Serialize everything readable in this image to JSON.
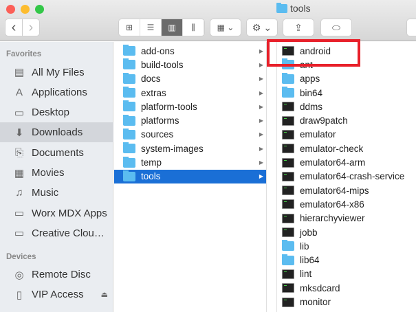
{
  "window": {
    "title": "tools"
  },
  "toolbar": {
    "back": "‹",
    "forward": "›",
    "view_icon": "⊞",
    "view_list": "☰",
    "view_column": "▥",
    "view_cover": "⫼",
    "arrange": "▦ ⌄",
    "action": "⚙ ⌄",
    "share": "⇪",
    "tags": "⬭"
  },
  "sidebar": {
    "favorites_header": "Favorites",
    "favorites": [
      {
        "label": "All My Files",
        "icon": "▤"
      },
      {
        "label": "Applications",
        "icon": "A"
      },
      {
        "label": "Desktop",
        "icon": "▭"
      },
      {
        "label": "Downloads",
        "icon": "⬇",
        "selected": true
      },
      {
        "label": "Documents",
        "icon": "⎘"
      },
      {
        "label": "Movies",
        "icon": "▦"
      },
      {
        "label": "Music",
        "icon": "♫"
      },
      {
        "label": "Worx MDX Apps",
        "icon": "▭"
      },
      {
        "label": "Creative Clou…",
        "icon": "▭"
      }
    ],
    "devices_header": "Devices",
    "devices": [
      {
        "label": "Remote Disc",
        "icon": "◎"
      },
      {
        "label": "VIP Access",
        "icon": "▯",
        "eject": "⏏"
      }
    ]
  },
  "column1": [
    {
      "name": "add-ons"
    },
    {
      "name": "build-tools"
    },
    {
      "name": "docs"
    },
    {
      "name": "extras"
    },
    {
      "name": "platform-tools"
    },
    {
      "name": "platforms"
    },
    {
      "name": "sources"
    },
    {
      "name": "system-images"
    },
    {
      "name": "temp"
    },
    {
      "name": "tools",
      "selected": true
    }
  ],
  "column1_arrow": "▶",
  "column2": [
    {
      "name": "android",
      "type": "exec"
    },
    {
      "name": "ant",
      "type": "folder"
    },
    {
      "name": "apps",
      "type": "folder"
    },
    {
      "name": "bin64",
      "type": "folder"
    },
    {
      "name": "ddms",
      "type": "exec"
    },
    {
      "name": "draw9patch",
      "type": "exec"
    },
    {
      "name": "emulator",
      "type": "exec"
    },
    {
      "name": "emulator-check",
      "type": "exec"
    },
    {
      "name": "emulator64-arm",
      "type": "exec"
    },
    {
      "name": "emulator64-crash-service",
      "type": "exec"
    },
    {
      "name": "emulator64-mips",
      "type": "exec"
    },
    {
      "name": "emulator64-x86",
      "type": "exec"
    },
    {
      "name": "hierarchyviewer",
      "type": "exec"
    },
    {
      "name": "jobb",
      "type": "exec"
    },
    {
      "name": "lib",
      "type": "folder"
    },
    {
      "name": "lib64",
      "type": "folder"
    },
    {
      "name": "lint",
      "type": "exec"
    },
    {
      "name": "mksdcard",
      "type": "exec"
    },
    {
      "name": "monitor",
      "type": "exec"
    }
  ],
  "colors": {
    "highlight": "#e8202a",
    "selection": "#1a6fd6",
    "folder": "#5bbcf0"
  }
}
